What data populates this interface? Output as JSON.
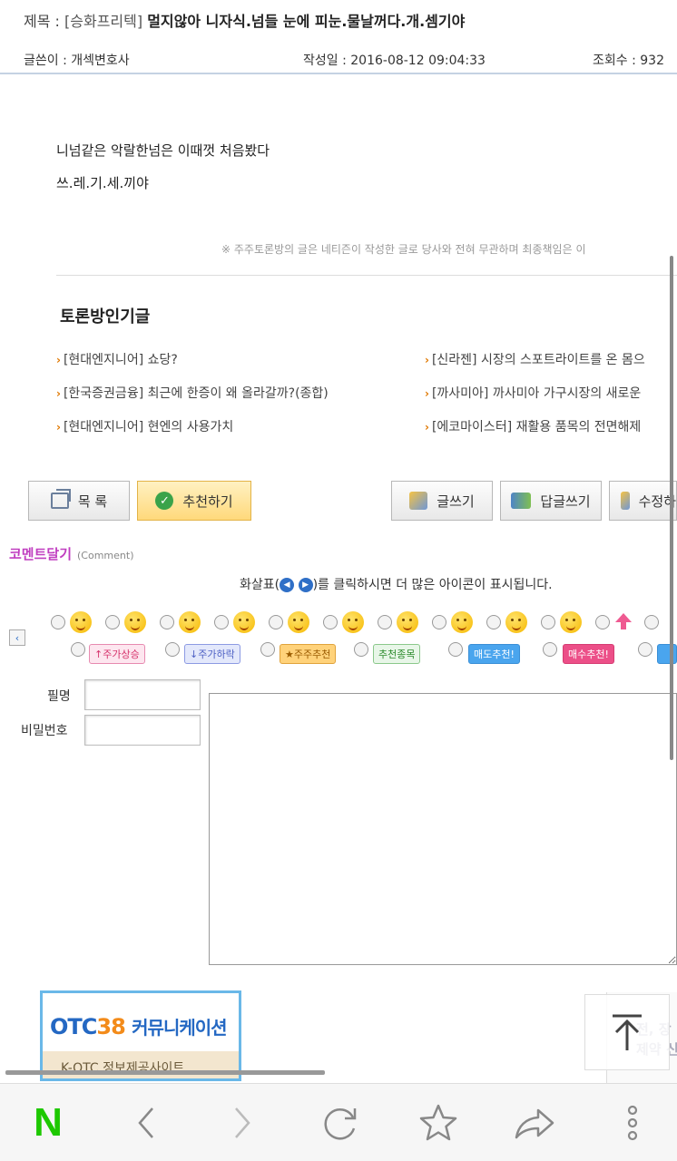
{
  "post": {
    "title_label": "제목 : ",
    "category": "[승화프리텍]",
    "title": "멀지않아 니자식.넘들 눈에 피눈.물날꺼다.개.셈기야",
    "author_label": "글쓴이 : 개섹변호사",
    "date_label": "작성일 : 2016-08-12 09:04:33",
    "views_label": "조회수 : 932",
    "body_line1": "니넘같은 악랄한넘은 이때껏 처음봤다",
    "body_line2": "쓰.레.기.세.끼야",
    "disclaimer": "※ 주주토론방의 글은 네티즌이 작성한 글로 당사와 전혀 무관하며 최종책임은 이"
  },
  "popular": {
    "title": "토론방인기글",
    "items": [
      "[현대엔지니어] 쇼당?",
      "[신라젠] 시장의 스포트라이트를 온 몸으",
      "[한국증권금융] 최근에 한증이 왜 올라갈까?(종합)",
      "[까사미아] 까사미아 가구시장의 새로운",
      "[현대엔지니어] 현엔의 사용가치",
      "[에코마이스터] 재활용 품목의 전면해제"
    ]
  },
  "buttons": {
    "list": "목 록",
    "recommend": "추천하기",
    "write": "글쓰기",
    "reply": "답글쓰기",
    "edit": "수정하"
  },
  "comment": {
    "header": "코멘트달기",
    "header_sub": "(Comment)",
    "hint_before": "화살표(",
    "hint_after": ")를 클릭하시면 더 많은 아이콘이 표시됩니다.",
    "tags": [
      "↑주가상승",
      "↓주가하락",
      "★주주추천",
      "추천종목",
      "매도추천!",
      "매수추천!"
    ],
    "name_label": "필명",
    "password_label": "비밀번호",
    "name_value": "",
    "password_value": ""
  },
  "ads": {
    "brand_a": "OTC",
    "brand_b": "38",
    "brand_c": "커뮤니케이션",
    "sub": "K-OTC 정보제공사이트",
    "right_text": "전, 장\n제약 신"
  },
  "icons": {
    "back": "chevron-left-icon",
    "forward": "chevron-right-icon",
    "reload": "reload-icon",
    "bookmark": "star-icon",
    "share": "share-icon",
    "menu": "more-vertical-icon",
    "top": "arrow-up-icon"
  },
  "colors": {
    "naver_green": "#1ec800",
    "comment_header": "#c03ec0",
    "accent_orange": "#e07800"
  },
  "browser": {
    "logo": "N"
  }
}
